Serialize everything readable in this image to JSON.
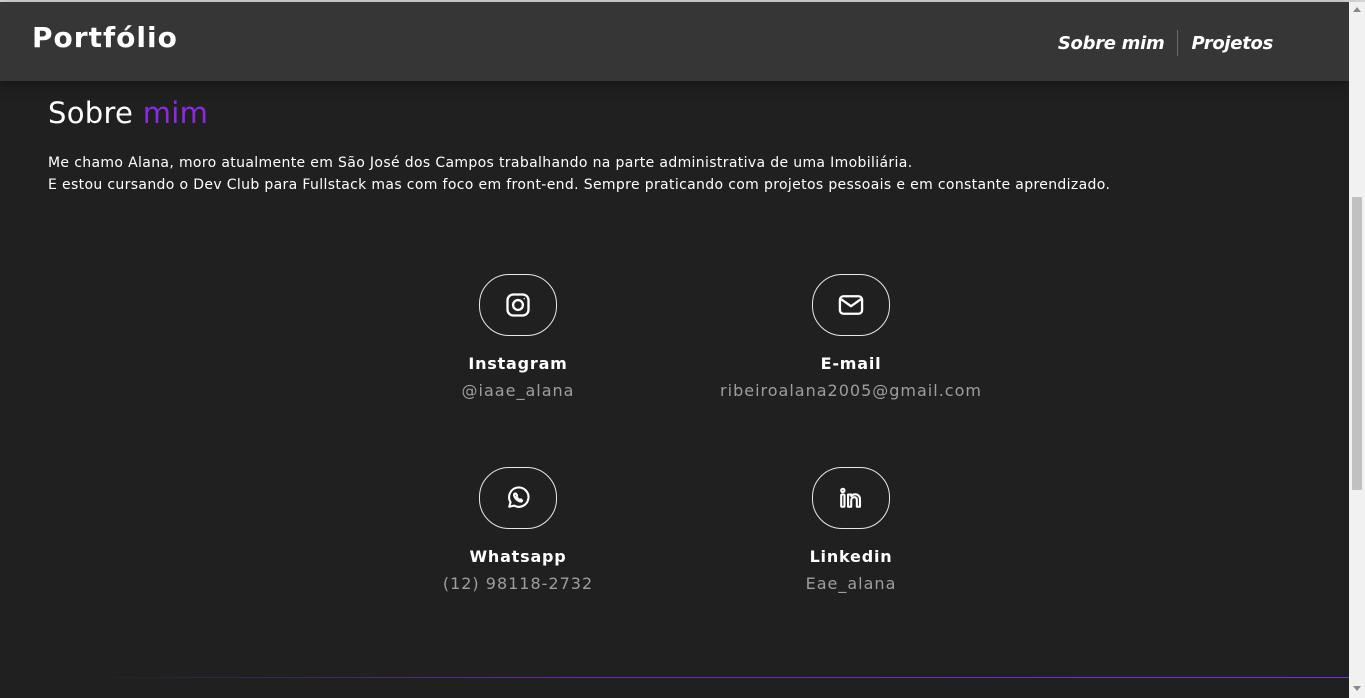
{
  "header": {
    "brand": "Portfólio",
    "nav": [
      {
        "label": "Sobre mim"
      },
      {
        "label": "Projetos"
      }
    ]
  },
  "about": {
    "title_main": "Sobre",
    "title_accent": "mim",
    "line1": "Me chamo Alana, moro atualmente em São José dos Campos trabalhando na parte administrativa de uma Imobiliária.",
    "line2": "E estou cursando o Dev Club para Fullstack mas com foco em front-end. Sempre praticando com projetos pessoais e em constante aprendizado."
  },
  "contacts": [
    {
      "icon": "instagram-icon",
      "title": "Instagram",
      "value": "@iaae_alana"
    },
    {
      "icon": "mail-icon",
      "title": "E-mail",
      "value": "ribeiroalana2005@gmail.com"
    },
    {
      "icon": "whatsapp-icon",
      "title": "Whatsapp",
      "value": "(12) 98118-2732"
    },
    {
      "icon": "linkedin-icon",
      "title": "Linkedin",
      "value": "Eae_alana"
    }
  ],
  "colors": {
    "background": "#202020",
    "header": "#363636",
    "accent": "#8a2be2",
    "muted_text": "#9e9e9e"
  }
}
